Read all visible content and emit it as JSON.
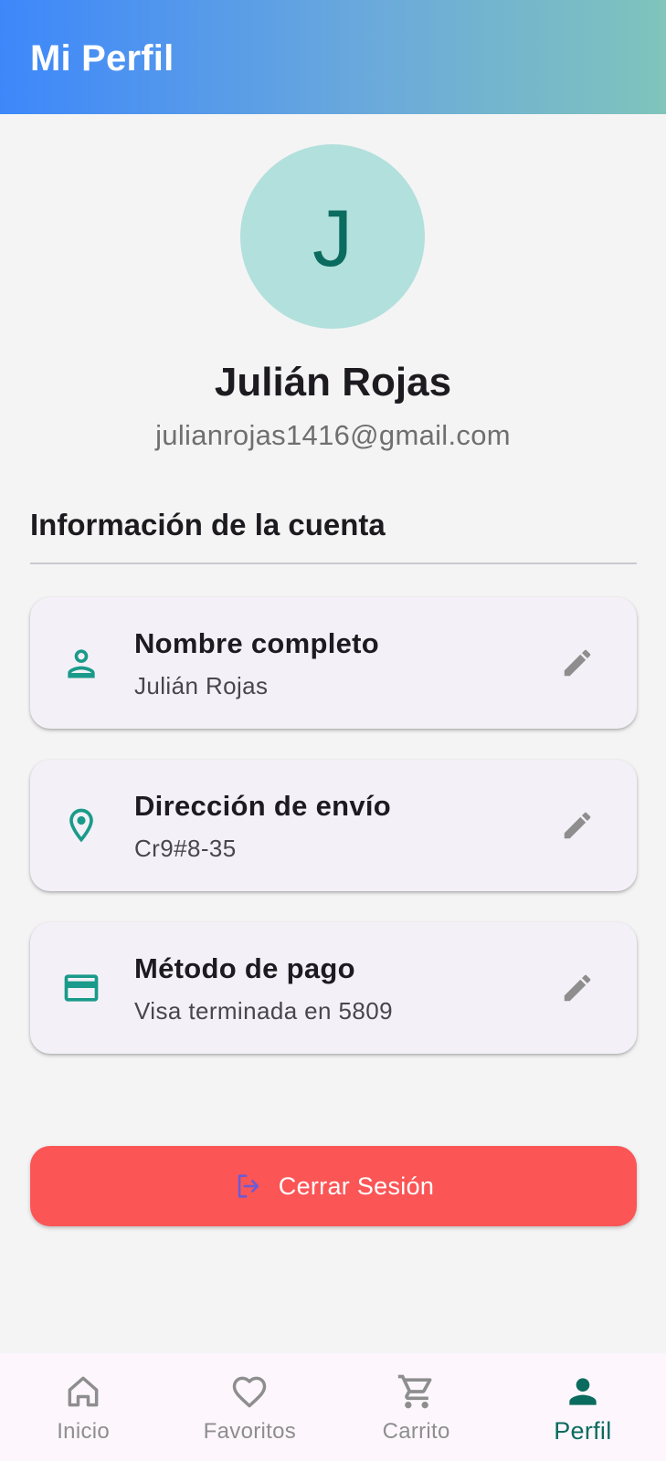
{
  "app_bar": {
    "title": "Mi Perfil"
  },
  "profile": {
    "initial": "J",
    "name": "Julián Rojas",
    "email": "julianrojas1416@gmail.com"
  },
  "section": {
    "title": "Información de la cuenta"
  },
  "cards": [
    {
      "icon": "person-icon",
      "label": "Nombre completo",
      "value": "Julián Rojas"
    },
    {
      "icon": "location-pin-icon",
      "label": "Dirección de envío",
      "value": "Cr9#8-35"
    },
    {
      "icon": "credit-card-icon",
      "label": "Método de pago",
      "value": "Visa terminada en 5809"
    }
  ],
  "logout": {
    "label": "Cerrar Sesión",
    "icon": "logout-icon"
  },
  "bottom_nav": {
    "items": [
      {
        "label": "Inicio",
        "icon": "home-icon",
        "active": false
      },
      {
        "label": "Favoritos",
        "icon": "heart-icon",
        "active": false
      },
      {
        "label": "Carrito",
        "icon": "cart-icon",
        "active": false
      },
      {
        "label": "Perfil",
        "icon": "person-icon",
        "active": true
      }
    ]
  },
  "colors": {
    "accent": "#0b6b5f",
    "icon_teal": "#1a9a8a",
    "danger": "#fb5556",
    "gradient_start": "#3d87fb",
    "gradient_end": "#80c4bc"
  }
}
